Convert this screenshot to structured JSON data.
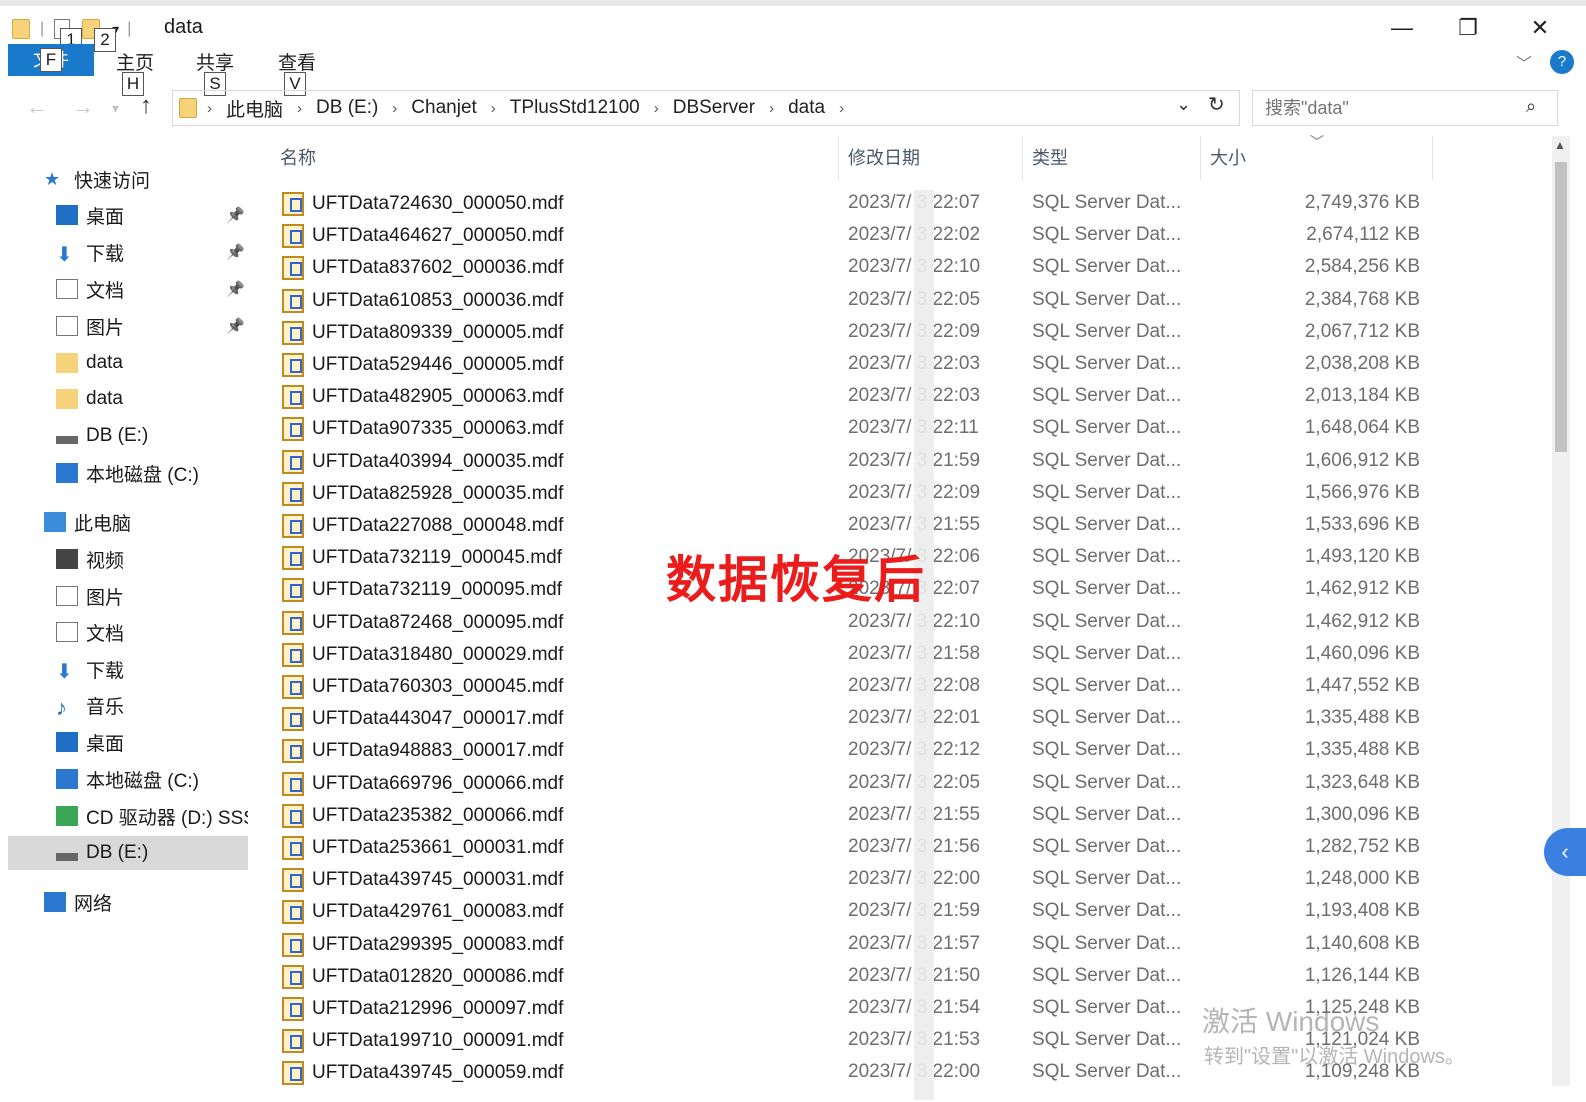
{
  "window": {
    "title": "data",
    "minimize": "—",
    "restore": "❐",
    "close": "✕"
  },
  "quick_access_tips": [
    "1",
    "2"
  ],
  "ribbon": {
    "file_tab": "文件",
    "file_keytip": "F",
    "tabs": [
      {
        "label": "主页",
        "keytip": "H"
      },
      {
        "label": "共享",
        "keytip": "S"
      },
      {
        "label": "查看",
        "keytip": "V"
      }
    ]
  },
  "address": {
    "path": [
      "此电脑",
      "DB (E:)",
      "Chanjet",
      "TPlusStd12100",
      "DBServer",
      "data"
    ],
    "search_placeholder": "搜索\"data\""
  },
  "sidebar": {
    "items": [
      {
        "label": "快速访问",
        "icon": "star-icon",
        "pinned": false
      },
      {
        "label": "桌面",
        "icon": "desktop-icon",
        "pinned": true
      },
      {
        "label": "下载",
        "icon": "download-icon",
        "pinned": true
      },
      {
        "label": "文档",
        "icon": "document-icon",
        "pinned": true
      },
      {
        "label": "图片",
        "icon": "picture-icon",
        "pinned": true
      },
      {
        "label": "data",
        "icon": "folder-icon",
        "pinned": false
      },
      {
        "label": "data",
        "icon": "folder-icon",
        "pinned": false
      },
      {
        "label": "DB (E:)",
        "icon": "drive-icon",
        "pinned": false
      },
      {
        "label": "本地磁盘 (C:)",
        "icon": "system-drive-icon",
        "pinned": false
      },
      {
        "label": "此电脑",
        "icon": "computer-icon",
        "pinned": false
      },
      {
        "label": "视频",
        "icon": "video-icon",
        "pinned": false
      },
      {
        "label": "图片",
        "icon": "picture-icon",
        "pinned": false
      },
      {
        "label": "文档",
        "icon": "document-icon",
        "pinned": false
      },
      {
        "label": "下载",
        "icon": "download-icon",
        "pinned": false
      },
      {
        "label": "音乐",
        "icon": "music-icon",
        "pinned": false
      },
      {
        "label": "桌面",
        "icon": "desktop-icon",
        "pinned": false
      },
      {
        "label": "本地磁盘 (C:)",
        "icon": "system-drive-icon",
        "pinned": false
      },
      {
        "label": "CD 驱动器 (D:) SSS",
        "icon": "cd-drive-icon",
        "pinned": false
      },
      {
        "label": "DB (E:)",
        "icon": "drive-icon",
        "pinned": false,
        "selected": true
      },
      {
        "label": "网络",
        "icon": "network-icon",
        "pinned": false
      }
    ]
  },
  "columns": {
    "name": "名称",
    "date": "修改日期",
    "type": "类型",
    "size": "大小"
  },
  "files": [
    {
      "name": "UFTData724630_000050.mdf",
      "date": "2023/7/  3 22:07",
      "type": "SQL Server Dat...",
      "size": "2,749,376 KB"
    },
    {
      "name": "UFTData464627_000050.mdf",
      "date": "2023/7/  3 22:02",
      "type": "SQL Server Dat...",
      "size": "2,674,112 KB"
    },
    {
      "name": "UFTData837602_000036.mdf",
      "date": "2023/7/  3 22:10",
      "type": "SQL Server Dat...",
      "size": "2,584,256 KB"
    },
    {
      "name": "UFTData610853_000036.mdf",
      "date": "2023/7/  3 22:05",
      "type": "SQL Server Dat...",
      "size": "2,384,768 KB"
    },
    {
      "name": "UFTData809339_000005.mdf",
      "date": "2023/7/  3 22:09",
      "type": "SQL Server Dat...",
      "size": "2,067,712 KB"
    },
    {
      "name": "UFTData529446_000005.mdf",
      "date": "2023/7/  3 22:03",
      "type": "SQL Server Dat...",
      "size": "2,038,208 KB"
    },
    {
      "name": "UFTData482905_000063.mdf",
      "date": "2023/7/  3 22:03",
      "type": "SQL Server Dat...",
      "size": "2,013,184 KB"
    },
    {
      "name": "UFTData907335_000063.mdf",
      "date": "2023/7/  3 22:11",
      "type": "SQL Server Dat...",
      "size": "1,648,064 KB"
    },
    {
      "name": "UFTData403994_000035.mdf",
      "date": "2023/7/  3 21:59",
      "type": "SQL Server Dat...",
      "size": "1,606,912 KB"
    },
    {
      "name": "UFTData825928_000035.mdf",
      "date": "2023/7/  3 22:09",
      "type": "SQL Server Dat...",
      "size": "1,566,976 KB"
    },
    {
      "name": "UFTData227088_000048.mdf",
      "date": "2023/7/  3 21:55",
      "type": "SQL Server Dat...",
      "size": "1,533,696 KB"
    },
    {
      "name": "UFTData732119_000045.mdf",
      "date": "2023/7/  3 22:06",
      "type": "SQL Server Dat...",
      "size": "1,493,120 KB"
    },
    {
      "name": "UFTData732119_000095.mdf",
      "date": "2023/7/  3 22:07",
      "type": "SQL Server Dat...",
      "size": "1,462,912 KB"
    },
    {
      "name": "UFTData872468_000095.mdf",
      "date": "2023/7/  3 22:10",
      "type": "SQL Server Dat...",
      "size": "1,462,912 KB"
    },
    {
      "name": "UFTData318480_000029.mdf",
      "date": "2023/7/  3 21:58",
      "type": "SQL Server Dat...",
      "size": "1,460,096 KB"
    },
    {
      "name": "UFTData760303_000045.mdf",
      "date": "2023/7/  3 22:08",
      "type": "SQL Server Dat...",
      "size": "1,447,552 KB"
    },
    {
      "name": "UFTData443047_000017.mdf",
      "date": "2023/7/  3 22:01",
      "type": "SQL Server Dat...",
      "size": "1,335,488 KB"
    },
    {
      "name": "UFTData948883_000017.mdf",
      "date": "2023/7/  3 22:12",
      "type": "SQL Server Dat...",
      "size": "1,335,488 KB"
    },
    {
      "name": "UFTData669796_000066.mdf",
      "date": "2023/7/  3 22:05",
      "type": "SQL Server Dat...",
      "size": "1,323,648 KB"
    },
    {
      "name": "UFTData235382_000066.mdf",
      "date": "2023/7/  3 21:55",
      "type": "SQL Server Dat...",
      "size": "1,300,096 KB"
    },
    {
      "name": "UFTData253661_000031.mdf",
      "date": "2023/7/  3 21:56",
      "type": "SQL Server Dat...",
      "size": "1,282,752 KB"
    },
    {
      "name": "UFTData439745_000031.mdf",
      "date": "2023/7/  3 22:00",
      "type": "SQL Server Dat...",
      "size": "1,248,000 KB"
    },
    {
      "name": "UFTData429761_000083.mdf",
      "date": "2023/7/  3 21:59",
      "type": "SQL Server Dat...",
      "size": "1,193,408 KB"
    },
    {
      "name": "UFTData299395_000083.mdf",
      "date": "2023/7/  3 21:57",
      "type": "SQL Server Dat...",
      "size": "1,140,608 KB"
    },
    {
      "name": "UFTData012820_000086.mdf",
      "date": "2023/7/  3 21:50",
      "type": "SQL Server Dat...",
      "size": "1,126,144 KB"
    },
    {
      "name": "UFTData212996_000097.mdf",
      "date": "2023/7/  3 21:54",
      "type": "SQL Server Dat...",
      "size": "1,125,248 KB"
    },
    {
      "name": "UFTData199710_000091.mdf",
      "date": "2023/7/  3 21:53",
      "type": "SQL Server Dat...",
      "size": "1,121,024 KB"
    },
    {
      "name": "UFTData439745_000059.mdf",
      "date": "2023/7/  3 22:00",
      "type": "SQL Server Dat...",
      "size": "1,109,248 KB"
    }
  ],
  "overlay_caption": "数据恢复后",
  "watermark": {
    "line1": "激活 Windows",
    "line2": "转到\"设置\"以激活 Windows。"
  },
  "colors": {
    "file_tab_bg": "#1979ca",
    "selection_bg": "#d9d9d9",
    "overlay_text": "#ea1c1c",
    "secondary_text": "#6d6d6d"
  }
}
